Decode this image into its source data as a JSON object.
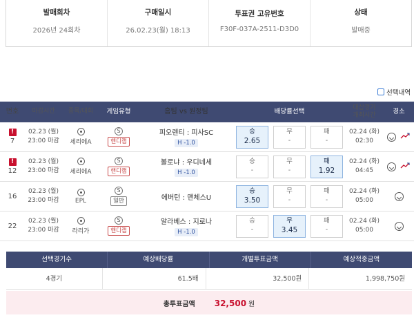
{
  "info": {
    "columns": [
      {
        "head": "발매회차",
        "value": "2026년 24회차"
      },
      {
        "head": "구매일시",
        "value": "26.02.23(월) 18:13"
      },
      {
        "head": "투표권 고유번호",
        "value": "F30F-037A-2511-D3D0"
      },
      {
        "head": "상태",
        "value": "발매중"
      }
    ]
  },
  "legend": {
    "label": "선택내역"
  },
  "table": {
    "headers": {
      "no": "번호",
      "deadline": "마감시간",
      "event": "종목/대회",
      "type": "게임유형",
      "teams": "홈팀 vs 원정팀",
      "odds": "배당률선택",
      "sched_line1": "대상경기",
      "sched_line2": "개최시간",
      "cancel": "경소"
    },
    "rows": [
      {
        "warn": "!",
        "no": "7",
        "deadline_date": "02.23 (월)",
        "deadline_time": "23:00 마감",
        "league": "세리에A",
        "type_icon": "S",
        "type": "핸디캡",
        "teams": "피오렌티 : 피사SC",
        "handicap": "H -1.0",
        "odds": [
          {
            "label": "승",
            "value": "2.65",
            "selected": true
          },
          {
            "label": "무",
            "value": "-",
            "selected": false
          },
          {
            "label": "패",
            "value": "-",
            "selected": false
          }
        ],
        "sched_date": "02.24 (화)",
        "sched_time": "02:30",
        "trend": true
      },
      {
        "warn": "!",
        "no": "12",
        "deadline_date": "02.23 (월)",
        "deadline_time": "23:00 마감",
        "league": "세리에A",
        "type_icon": "S",
        "type": "핸디캡",
        "teams": "볼로냐 : 우디네세",
        "handicap": "H -1.0",
        "odds": [
          {
            "label": "승",
            "value": "-",
            "selected": false
          },
          {
            "label": "무",
            "value": "-",
            "selected": false
          },
          {
            "label": "패",
            "value": "1.92",
            "selected": true
          }
        ],
        "sched_date": "02.24 (화)",
        "sched_time": "04:45",
        "trend": true
      },
      {
        "warn": "",
        "no": "16",
        "deadline_date": "02.23 (월)",
        "deadline_time": "23:00 마감",
        "league": "EPL",
        "type_icon": "S",
        "type": "일반",
        "teams": "에버턴 : 맨체스U",
        "handicap": "",
        "odds": [
          {
            "label": "승",
            "value": "3.50",
            "selected": true
          },
          {
            "label": "무",
            "value": "-",
            "selected": false
          },
          {
            "label": "패",
            "value": "-",
            "selected": false
          }
        ],
        "sched_date": "02.24 (화)",
        "sched_time": "05:00",
        "trend": false
      },
      {
        "warn": "",
        "no": "22",
        "deadline_date": "02.23 (월)",
        "deadline_time": "23:00 마감",
        "league": "라리가",
        "type_icon": "S",
        "type": "핸디캡",
        "teams": "알라베스 : 지로나",
        "handicap": "H -1.0",
        "odds": [
          {
            "label": "승",
            "value": "-",
            "selected": false
          },
          {
            "label": "무",
            "value": "3.45",
            "selected": true
          },
          {
            "label": "패",
            "value": "-",
            "selected": false
          }
        ],
        "sched_date": "02.24 (화)",
        "sched_time": "05:00",
        "trend": false
      }
    ]
  },
  "summary": {
    "headers": [
      "선택경기수",
      "예상배당률",
      "개별투표금액",
      "예상적중금액"
    ],
    "values": [
      "4경기",
      "61.5배",
      "32,500원",
      "1,998,750원"
    ],
    "total_label": "총투표금액",
    "total_value": "32,500",
    "total_unit": "원"
  },
  "colors": {
    "header_bg": "#3f4a72",
    "selected_odd": "#e6f1fb",
    "warn": "#c8102e",
    "total_bg": "#fcecef"
  },
  "icons": {
    "warn": "warning-icon",
    "league": "soccer-ball-icon",
    "type": "sport-s-icon",
    "pin": "location-pin-icon",
    "trend": "trend-chart-icon"
  }
}
